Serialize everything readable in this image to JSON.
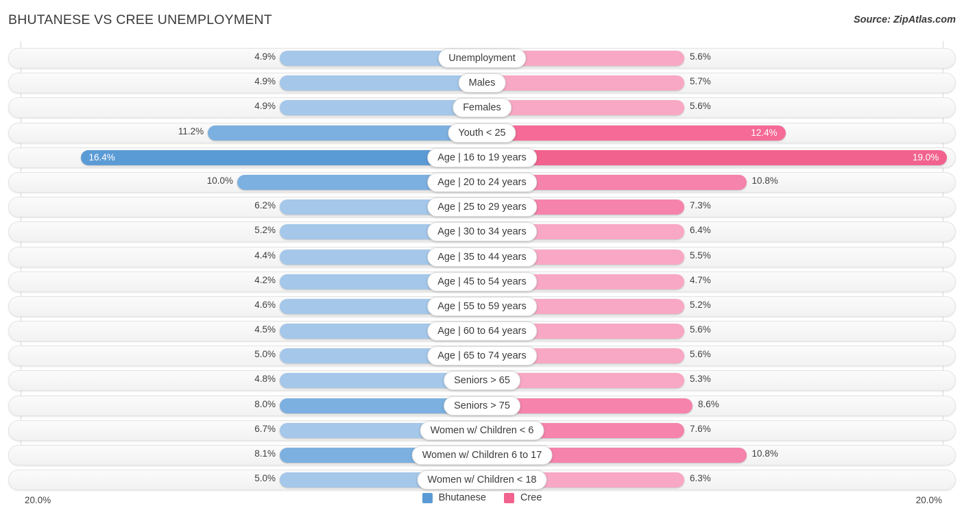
{
  "header": {
    "title": "BHUTANESE VS CREE UNEMPLOYMENT",
    "source": "Source: ZipAtlas.com"
  },
  "axis": {
    "left_label": "20.0%",
    "right_label": "20.0%",
    "max": 20.0
  },
  "legend": {
    "items": [
      {
        "label": "Bhutanese",
        "color": "#5b9bd5"
      },
      {
        "label": "Cree",
        "color": "#f2628f"
      }
    ]
  },
  "colors": {
    "blue_light": "#a4c7ea",
    "blue_mid": "#7cb0e0",
    "blue_dark": "#5b9bd5",
    "pink_light": "#f8a8c4",
    "pink_mid": "#f583ab",
    "pink_dark": "#f2628f",
    "track_bg": "#f5f5f5",
    "gridline": "#d7d7d7",
    "text": "#3b3b3b"
  },
  "chart_data": {
    "type": "bar",
    "orientation": "horizontal-diverging",
    "title": "BHUTANESE VS CREE UNEMPLOYMENT",
    "subtitle": "Source: ZipAtlas.com",
    "xlabel": "",
    "ylabel": "",
    "xlim": [
      20.0,
      20.0
    ],
    "unit": "%",
    "grid": true,
    "legend_position": "bottom-center",
    "categories": [
      "Unemployment",
      "Males",
      "Females",
      "Youth < 25",
      "Age | 16 to 19 years",
      "Age | 20 to 24 years",
      "Age | 25 to 29 years",
      "Age | 30 to 34 years",
      "Age | 35 to 44 years",
      "Age | 45 to 54 years",
      "Age | 55 to 59 years",
      "Age | 60 to 64 years",
      "Age | 65 to 74 years",
      "Seniors > 65",
      "Seniors > 75",
      "Women w/ Children < 6",
      "Women w/ Children 6 to 17",
      "Women w/ Children < 18"
    ],
    "series": [
      {
        "name": "Bhutanese",
        "color": "#5b9bd5",
        "side": "left",
        "values": [
          4.9,
          4.9,
          4.9,
          11.2,
          16.4,
          10.0,
          6.2,
          5.2,
          4.4,
          4.2,
          4.6,
          4.5,
          5.0,
          4.8,
          8.0,
          6.7,
          8.1,
          5.0
        ]
      },
      {
        "name": "Cree",
        "color": "#f2628f",
        "side": "right",
        "values": [
          5.6,
          5.7,
          5.6,
          12.4,
          19.0,
          10.8,
          7.3,
          6.4,
          5.5,
          4.7,
          5.2,
          5.6,
          5.6,
          5.3,
          8.6,
          7.6,
          10.8,
          6.3
        ]
      }
    ]
  },
  "rows": [
    {
      "label": "Unemployment",
      "left": "4.9%",
      "right": "5.6%",
      "lv": 4.9,
      "rv": 5.6
    },
    {
      "label": "Males",
      "left": "4.9%",
      "right": "5.7%",
      "lv": 4.9,
      "rv": 5.7
    },
    {
      "label": "Females",
      "left": "4.9%",
      "right": "5.6%",
      "lv": 4.9,
      "rv": 5.6
    },
    {
      "label": "Youth < 25",
      "left": "11.2%",
      "right": "12.4%",
      "lv": 11.2,
      "rv": 12.4
    },
    {
      "label": "Age | 16 to 19 years",
      "left": "16.4%",
      "right": "19.0%",
      "lv": 16.4,
      "rv": 19.0
    },
    {
      "label": "Age | 20 to 24 years",
      "left": "10.0%",
      "right": "10.8%",
      "lv": 10.0,
      "rv": 10.8
    },
    {
      "label": "Age | 25 to 29 years",
      "left": "6.2%",
      "right": "7.3%",
      "lv": 6.2,
      "rv": 7.3
    },
    {
      "label": "Age | 30 to 34 years",
      "left": "5.2%",
      "right": "6.4%",
      "lv": 5.2,
      "rv": 6.4
    },
    {
      "label": "Age | 35 to 44 years",
      "left": "4.4%",
      "right": "5.5%",
      "lv": 4.4,
      "rv": 5.5
    },
    {
      "label": "Age | 45 to 54 years",
      "left": "4.2%",
      "right": "4.7%",
      "lv": 4.2,
      "rv": 4.7
    },
    {
      "label": "Age | 55 to 59 years",
      "left": "4.6%",
      "right": "5.2%",
      "lv": 4.6,
      "rv": 5.2
    },
    {
      "label": "Age | 60 to 64 years",
      "left": "4.5%",
      "right": "5.6%",
      "lv": 4.5,
      "rv": 5.6
    },
    {
      "label": "Age | 65 to 74 years",
      "left": "5.0%",
      "right": "5.6%",
      "lv": 5.0,
      "rv": 5.6
    },
    {
      "label": "Seniors > 65",
      "left": "4.8%",
      "right": "5.3%",
      "lv": 4.8,
      "rv": 5.3
    },
    {
      "label": "Seniors > 75",
      "left": "8.0%",
      "right": "8.6%",
      "lv": 8.0,
      "rv": 8.6
    },
    {
      "label": "Women w/ Children < 6",
      "left": "6.7%",
      "right": "7.6%",
      "lv": 6.7,
      "rv": 7.6
    },
    {
      "label": "Women w/ Children 6 to 17",
      "left": "8.1%",
      "right": "10.8%",
      "lv": 8.1,
      "rv": 10.8
    },
    {
      "label": "Women w/ Children < 18",
      "left": "5.0%",
      "right": "6.3%",
      "lv": 5.0,
      "rv": 6.3
    }
  ]
}
